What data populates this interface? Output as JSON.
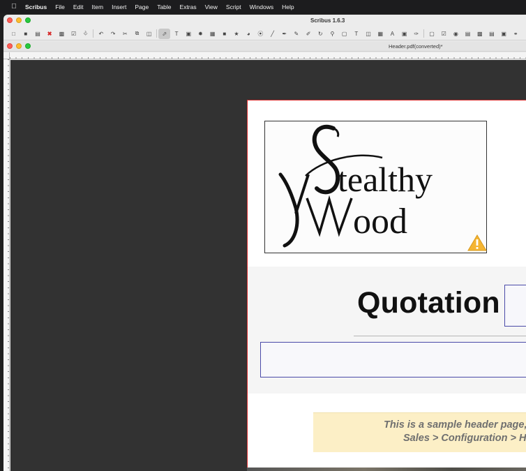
{
  "menubar": {
    "app_name": "Scribus",
    "items": [
      "File",
      "Edit",
      "Item",
      "Insert",
      "Page",
      "Table",
      "Extras",
      "View",
      "Script",
      "Windows",
      "Help"
    ]
  },
  "window": {
    "title": "Scribus 1.6.3"
  },
  "toolbar": {
    "buttons": [
      "new-document",
      "open",
      "save",
      "close",
      "print",
      "preflight",
      "export-pdf",
      "undo",
      "redo",
      "cut",
      "copy",
      "paste",
      "select",
      "text-frame",
      "image-frame",
      "render-frame",
      "table",
      "shape",
      "polygon",
      "arc",
      "spiral",
      "line",
      "bezier",
      "freehand",
      "calligraphic",
      "rotate",
      "zoom",
      "edit-contents",
      "edit-text",
      "link-frames",
      "unlink-frames",
      "measurements",
      "copy-properties",
      "eyedropper",
      "pdf-push-button",
      "pdf-checkbox",
      "pdf-radio",
      "pdf-text-field",
      "pdf-combo-box",
      "pdf-list-box",
      "pdf-text-annotation",
      "pdf-link-annotation"
    ]
  },
  "document": {
    "title": "Header.pdf(converted)*"
  },
  "page": {
    "logo_text_line1": "Stealthy",
    "logo_text_line2": "Wood",
    "heading": "Quotation",
    "note_line1": "This is a sample header page,",
    "note_line2": "Sales > Configuration > He"
  },
  "colors": {
    "page_border": "#d93030",
    "frame_outline": "#4a4aa8",
    "note_background": "#fcefc6",
    "canvas_background": "#323232",
    "warning": "#f5b532"
  }
}
